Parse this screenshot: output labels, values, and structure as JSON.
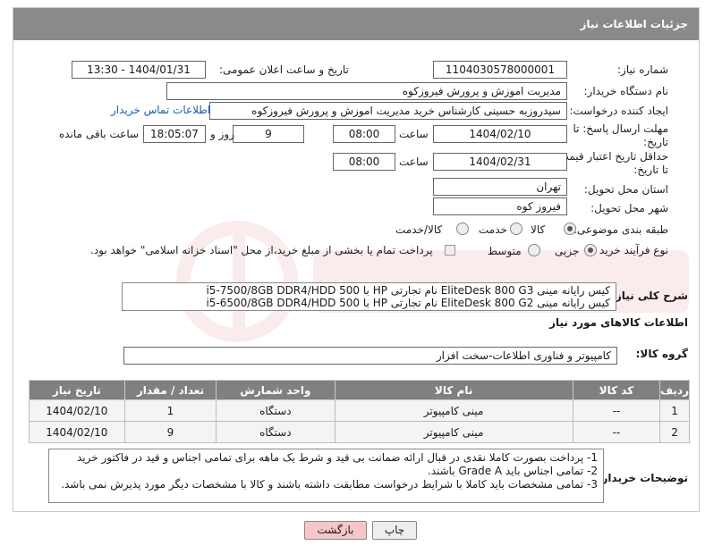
{
  "header": {
    "title": "جزئیات اطلاعات نیاز"
  },
  "form": {
    "need_number_label": "شماره نیاز:",
    "need_number": "1104030578000001",
    "announce_label": "تاریخ و ساعت اعلان عمومی:",
    "announce_value": "1404/01/31 - 13:30",
    "buyer_org_label": "نام دستگاه خریدار:",
    "buyer_org": "مدیریت اموزش و پرورش فیروزکوه",
    "requester_label": "ایجاد کننده درخواست:",
    "requester": "سیدروزبه حسینی کارشناس خرید مدیریت اموزش و پرورش فیروزکوه",
    "buyer_contact_link": "اطلاعات تماس خریدار",
    "reply_deadline_label": "مهلت ارسال پاسخ: تا تاریخ:",
    "reply_date": "1404/02/10",
    "time_label": "ساعت",
    "reply_time": "08:00",
    "days_value": "9",
    "days_and_label": "روز و",
    "remaining_time": "18:05:07",
    "remaining_label": "ساعت باقی مانده",
    "price_validity_label": "حداقل تاریخ اعتبار قیمت: تا تاریخ:",
    "validity_date": "1404/02/31",
    "validity_time": "08:00",
    "delivery_province_label": "استان محل تحویل:",
    "delivery_province": "تهران",
    "delivery_city_label": "شهر محل تحویل:",
    "delivery_city": "فیروز کوه",
    "category_label": "طبقه بندی موضوعی:",
    "category_options": [
      "کالا",
      "خدمت",
      "کالا/خدمت"
    ],
    "process_label": "نوع فرآیند خرید :",
    "process_options": [
      "جزیی",
      "متوسط"
    ],
    "payment_note": "پرداخت تمام یا بخشی از مبلغ خرید،از محل \"اسناد خزانه اسلامی\" خواهد بود."
  },
  "summary": {
    "label": "شرح کلی نیاز:",
    "lines": [
      "کیس رایانه مینی EliteDesk 800 G3 نام تجارتی HP با i5-7500/8GB DDR4/HDD 500",
      "کیس رایانه مینی EliteDesk 800 G2 نام تجارتی HP با i5-6500/8GB DDR4/HDD 500"
    ]
  },
  "goods": {
    "section_title": "اطلاعات کالاهای مورد نیاز",
    "group_label": "گروه کالا:",
    "group_value": "کامپیوتر و فناوری اطلاعات-سخت افزار",
    "columns": [
      "ردیف",
      "کد کالا",
      "نام کالا",
      "واحد شمارش",
      "تعداد / مقدار",
      "تاریخ نیاز"
    ],
    "rows": [
      [
        "1",
        "--",
        "مینی کامپیوتر",
        "دستگاه",
        "1",
        "1404/02/10"
      ],
      [
        "2",
        "--",
        "مینی کامپیوتر",
        "دستگاه",
        "9",
        "1404/02/10"
      ]
    ]
  },
  "notes": {
    "label": "توضیحات خریدار:",
    "lines": [
      "1- پرداخت بصورت کاملا نقدی در قبال ارائه ضمانت بی قید و شرط یک ماهه برای تمامی اجناس و قید در فاکتور خرید",
      "2- تمامی اجناس باید Grade A باشند.",
      "3- تمامی مشخصات باید کاملا با شرایط درخواست مطابقت داشته باشند و کالا با مشخصات دیگر مورد پذیرش نمی باشد."
    ]
  },
  "buttons": {
    "print": "چاپ",
    "back": "بازگشت"
  },
  "colors": {
    "header_bg": "#8a8a8a",
    "link": "#1a5fb4",
    "back_btn_bg": "#f7c7c7",
    "print_btn_bg": "#eeeeee"
  }
}
